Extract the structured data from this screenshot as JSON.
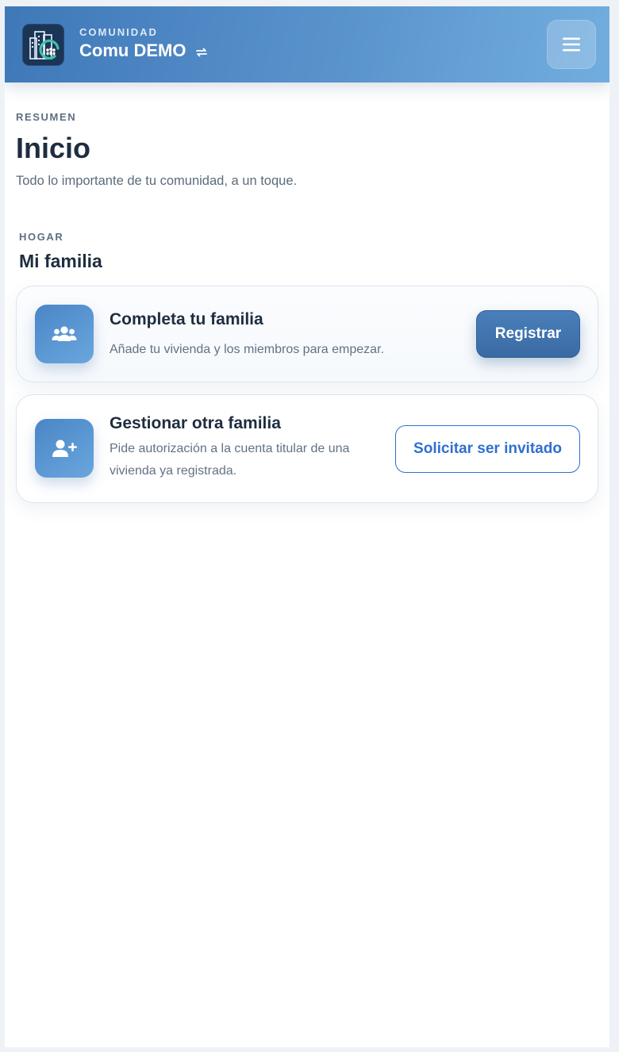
{
  "header": {
    "eyebrow": "COMUNIDAD",
    "community_name": "Comu DEMO",
    "logo_icon": "community-buildings-logo",
    "switch_icon": "swap-arrows-icon",
    "menu_icon": "hamburger-menu-icon"
  },
  "summary": {
    "eyebrow": "RESUMEN",
    "title": "Inicio",
    "subtitle": "Todo lo importante de tu comunidad, a un toque."
  },
  "household": {
    "eyebrow": "HOGAR",
    "title": "Mi familia",
    "cards": [
      {
        "icon": "users-group-icon",
        "title": "Completa tu familia",
        "description": "Añade tu vivienda y los miembros para empezar.",
        "action_label": "Registrar"
      },
      {
        "icon": "user-plus-icon",
        "title": "Gestionar otra familia",
        "description": "Pide autorización a la cuenta titular de una vivienda ya registrada.",
        "action_label": "Solicitar ser invitado"
      }
    ]
  },
  "colors": {
    "header_gradient_start": "#3f78b8",
    "header_gradient_end": "#72addf",
    "primary_button": "#3a6aa4",
    "outline_button": "#2f6fd0",
    "text_dark": "#1e2d3f",
    "text_muted": "#627284"
  }
}
